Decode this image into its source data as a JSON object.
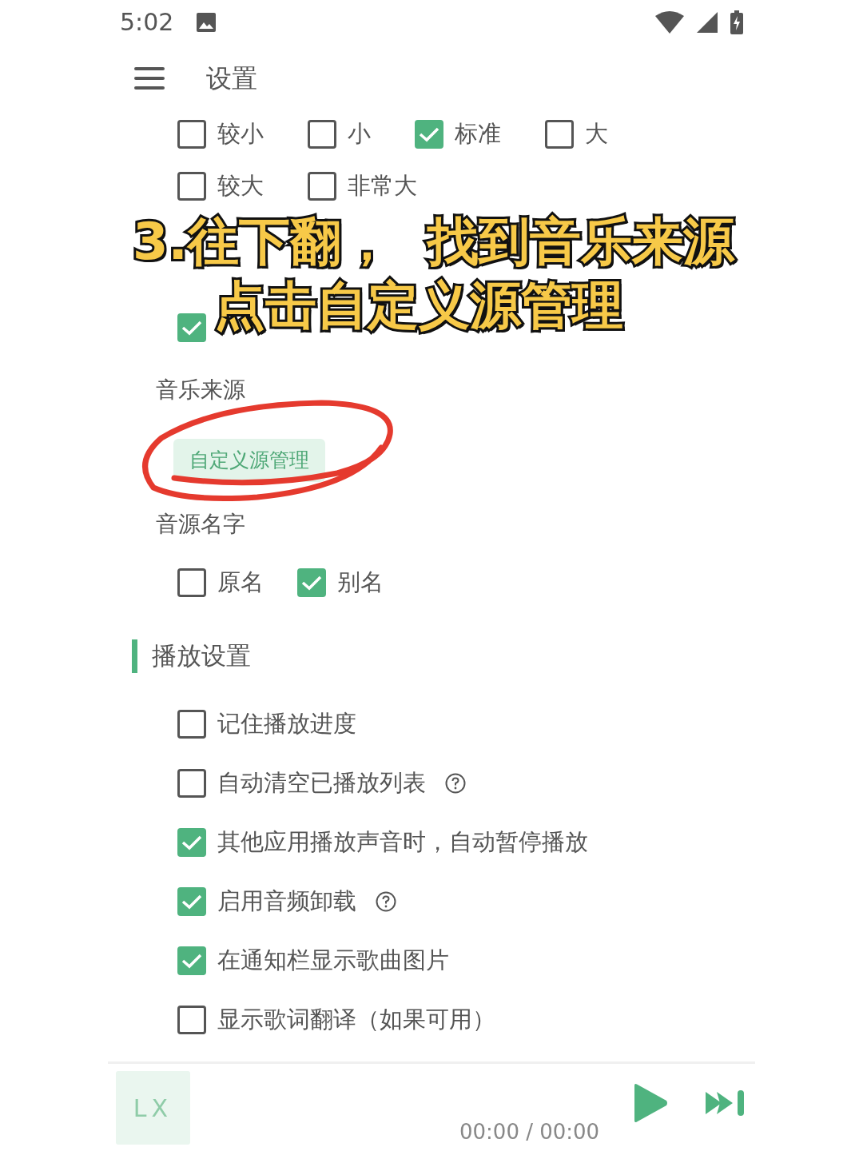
{
  "status_bar": {
    "time": "5:02"
  },
  "toolbar": {
    "title": "设置"
  },
  "font_size_options": [
    {
      "label": "较小",
      "checked": false
    },
    {
      "label": "小",
      "checked": false
    },
    {
      "label": "标准",
      "checked": true
    },
    {
      "label": "大",
      "checked": false
    },
    {
      "label": "较大",
      "checked": false
    },
    {
      "label": "非常大",
      "checked": false
    }
  ],
  "covered_option": {
    "checked": true
  },
  "music_source": {
    "heading": "音乐来源",
    "button": "自定义源管理"
  },
  "source_name": {
    "heading": "音源名字",
    "options": [
      {
        "label": "原名",
        "checked": false
      },
      {
        "label": "别名",
        "checked": true
      }
    ]
  },
  "playback_settings": {
    "heading": "播放设置",
    "options": [
      {
        "label": "记住播放进度",
        "checked": false,
        "help": false
      },
      {
        "label": "自动清空已播放列表",
        "checked": false,
        "help": true
      },
      {
        "label": "其他应用播放声音时，自动暂停播放",
        "checked": true,
        "help": false
      },
      {
        "label": "启用音频卸载",
        "checked": true,
        "help": true
      },
      {
        "label": "在通知栏显示歌曲图片",
        "checked": true,
        "help": false
      },
      {
        "label": "显示歌词翻译（如果可用）",
        "checked": false,
        "help": false
      }
    ]
  },
  "player": {
    "logo": "LX",
    "time": "00:00 / 00:00"
  },
  "annotation": {
    "caption": [
      "3.往下翻，  找到音乐来源",
      "点击自定义源管理"
    ]
  }
}
